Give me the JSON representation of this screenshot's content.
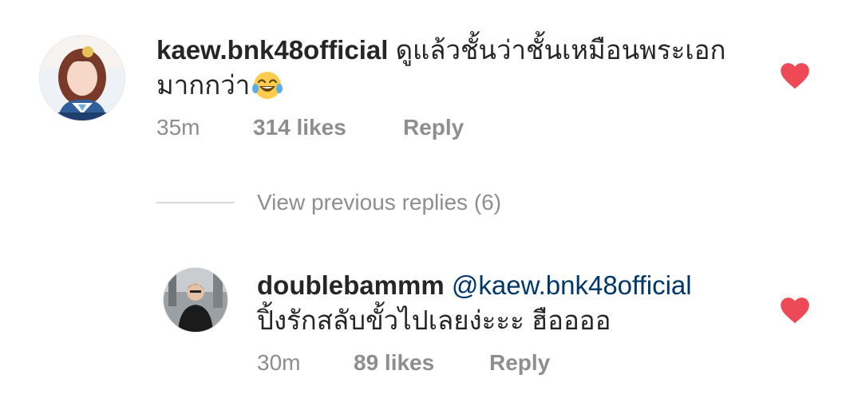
{
  "comments": [
    {
      "username": "kaew.bnk48official",
      "text": "ดูแล้วชั้นว่าชั้นเหมือนพระเอกมากกว่า",
      "emoji": "face-with-tears-of-joy",
      "time": "35m",
      "likes": "314 likes",
      "reply": "Reply",
      "liked": true
    },
    {
      "username": "doublebammm",
      "mention": "@kaew.bnk48official",
      "text": "ปิ้งรักสลับขั้วไปเลยง่ะะะ ฮืออออ",
      "time": "30m",
      "likes": "89 likes",
      "reply": "Reply",
      "liked": true
    }
  ],
  "view_previous_replies": "View previous replies (6)",
  "colors": {
    "heart": "#ed4956",
    "text": "#262626",
    "meta": "#8e8e8e",
    "mention": "#00376b"
  }
}
